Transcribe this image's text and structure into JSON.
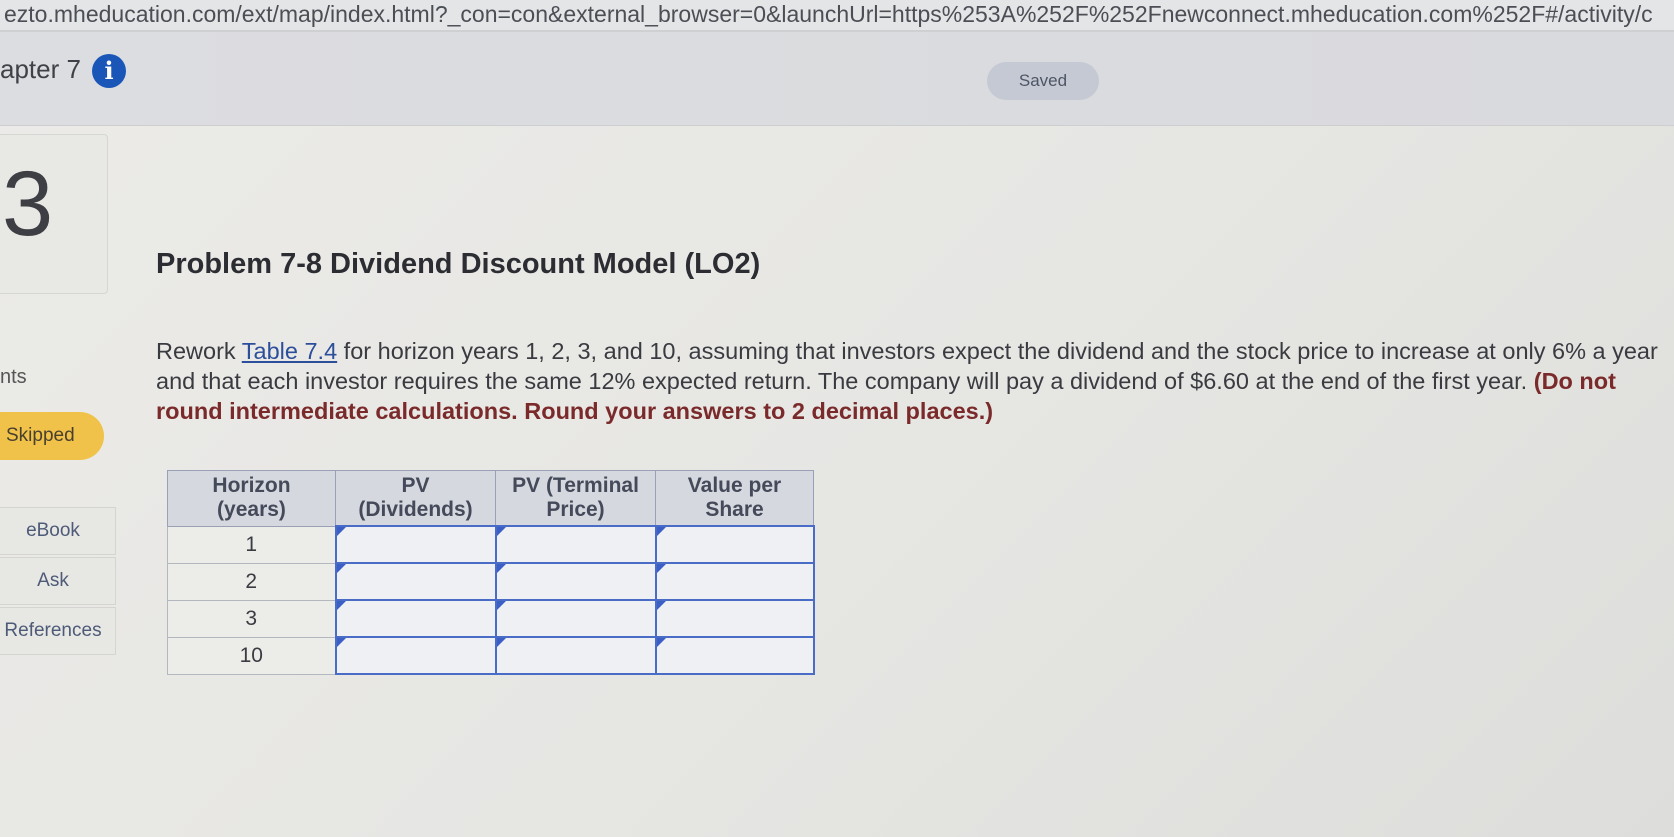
{
  "browser": {
    "url": "ezto.mheducation.com/ext/map/index.html?_con=con&external_browser=0&launchUrl=https%253A%252F%252Fnewconnect.mheducation.com%252F#/activity/c"
  },
  "header": {
    "chapter": "apter 7",
    "info_icon": "info-icon",
    "saved_label": "Saved"
  },
  "sidebar": {
    "question_number": "3",
    "points_label": "nts",
    "status": "Skipped",
    "buttons": [
      "eBook",
      "Ask",
      "References"
    ]
  },
  "problem": {
    "title": "Problem 7-8 Dividend Discount Model (LO2)",
    "text_before_link": "Rework ",
    "link_text": "Table 7.4",
    "text_after_link": " for horizon years 1, 2, 3, and 10, assuming that investors expect the dividend and the stock price to increase at only 6% a year and that each investor requires the same 12% expected return. The company will pay a dividend of $6.60 at the end of the first year. ",
    "instructions": "(Do not round intermediate calculations. Round your answers to 2 decimal places.)"
  },
  "table": {
    "headers": [
      {
        "line1": "Horizon",
        "line2": "(years)"
      },
      {
        "line1": "PV",
        "line2": "(Dividends)"
      },
      {
        "line1": "PV (Terminal",
        "line2": "Price)"
      },
      {
        "line1": "Value per",
        "line2": "Share"
      }
    ],
    "rows": [
      {
        "horizon": "1",
        "pv_dividends": "",
        "pv_terminal": "",
        "value_per_share": ""
      },
      {
        "horizon": "2",
        "pv_dividends": "",
        "pv_terminal": "",
        "value_per_share": ""
      },
      {
        "horizon": "3",
        "pv_dividends": "",
        "pv_terminal": "",
        "value_per_share": ""
      },
      {
        "horizon": "10",
        "pv_dividends": "",
        "pv_terminal": "",
        "value_per_share": ""
      }
    ]
  }
}
